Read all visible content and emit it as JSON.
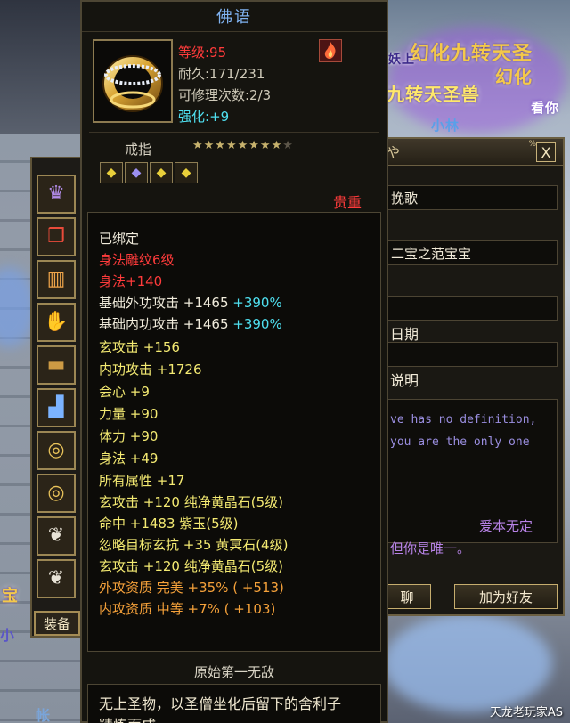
{
  "world": {
    "banners": [
      "幻化九转天圣",
      "幻化",
      "九转天圣兽",
      "妖上",
      "看你",
      "小林",
      "小",
      "宝",
      "小",
      "帐"
    ]
  },
  "watermark": "天龙老玩家AS",
  "equipment": {
    "tab_label": "装备",
    "slots": [
      {
        "name": "hat",
        "icon": "helmet-icon"
      },
      {
        "name": "charm",
        "icon": "charm-icon"
      },
      {
        "name": "wrist",
        "icon": "bracer-icon"
      },
      {
        "name": "gloves",
        "icon": "gloves-icon"
      },
      {
        "name": "belt",
        "icon": "belt-icon"
      },
      {
        "name": "boots",
        "icon": "boots-icon"
      },
      {
        "name": "ring1",
        "icon": "ring-icon"
      },
      {
        "name": "ring2",
        "icon": "ring-icon"
      },
      {
        "name": "amulet1",
        "icon": "amulet-icon"
      },
      {
        "name": "amulet2",
        "icon": "amulet-icon"
      }
    ]
  },
  "profile": {
    "title_partial": "や",
    "small_label": "%",
    "name_value": "挽歌",
    "partner_value": "二宝之范宝宝",
    "date_label": "日期",
    "desc_label": "说明",
    "desc_en_1": "ve has no definition,",
    "desc_en_2": "you are the only one",
    "desc_cn_1": "爱本无定",
    "desc_cn_2": "但你是唯一。",
    "btn_chat": "聊",
    "btn_add_friend": "加为好友",
    "close_label": "X"
  },
  "tooltip": {
    "title": "佛语",
    "level_label": "等级:95",
    "durability_label": "耐久:171/231",
    "repair_label": "可修理次数:2/3",
    "enhance_label": "强化:",
    "enhance_value": "+9",
    "item_type": "戒指",
    "stars_filled": 8,
    "stars_total": 9,
    "star_filled_glyph": "★★★★★★★★",
    "star_empty_glyph": "★",
    "gems": [
      "gem-yellow-icon",
      "gem-purple-icon",
      "gem-yellow-icon",
      "gem-yellow-icon"
    ],
    "rarity": "贵重",
    "stats": [
      {
        "text": "已绑定",
        "color": "white"
      },
      {
        "text": "身法雕纹6级",
        "color": "red"
      },
      {
        "text": "身法+140",
        "color": "red"
      },
      {
        "text": "基础外功攻击 +1465 ",
        "extra": "+390%",
        "color": "white"
      },
      {
        "text": "基础内功攻击 +1465 ",
        "extra": "+390%",
        "color": "white"
      },
      {
        "text": "玄攻击 +156",
        "color": "yellow"
      },
      {
        "text": "内功攻击 +1726",
        "color": "yellow"
      },
      {
        "text": "会心 +9",
        "color": "yellow"
      },
      {
        "text": "力量 +90",
        "color": "yellow"
      },
      {
        "text": "体力 +90",
        "color": "yellow"
      },
      {
        "text": "身法 +49",
        "color": "yellow"
      },
      {
        "text": "所有属性 +17",
        "color": "yellow"
      },
      {
        "text": "玄攻击 +120 纯净黄晶石(5级)",
        "color": "yellow"
      },
      {
        "text": "命中 +1483 紫玉(5级)",
        "color": "yellow"
      },
      {
        "text": "忽略目标玄抗 +35 黄冥石(4级)",
        "color": "yellow"
      },
      {
        "text": "玄攻击 +120 纯净黄晶石(5级)",
        "color": "yellow"
      },
      {
        "text": "外攻资质   完美 +35% ( +513)",
        "color": "orange"
      },
      {
        "text": "内攻资质   中等 +7% ( +103)",
        "color": "orange"
      }
    ],
    "set_name": "原始第一无敌",
    "lore_1": "无上圣物，以圣僧坐化后留下的舍利子",
    "lore_2": "精炼而成"
  },
  "colors": {
    "tooltip_bg": "#15140f",
    "title_blue": "#7fb2f0",
    "red": "#ff3b3b",
    "yellow": "#f4ea72",
    "orange": "#f5a13a",
    "cyan": "#4fe0f0"
  }
}
